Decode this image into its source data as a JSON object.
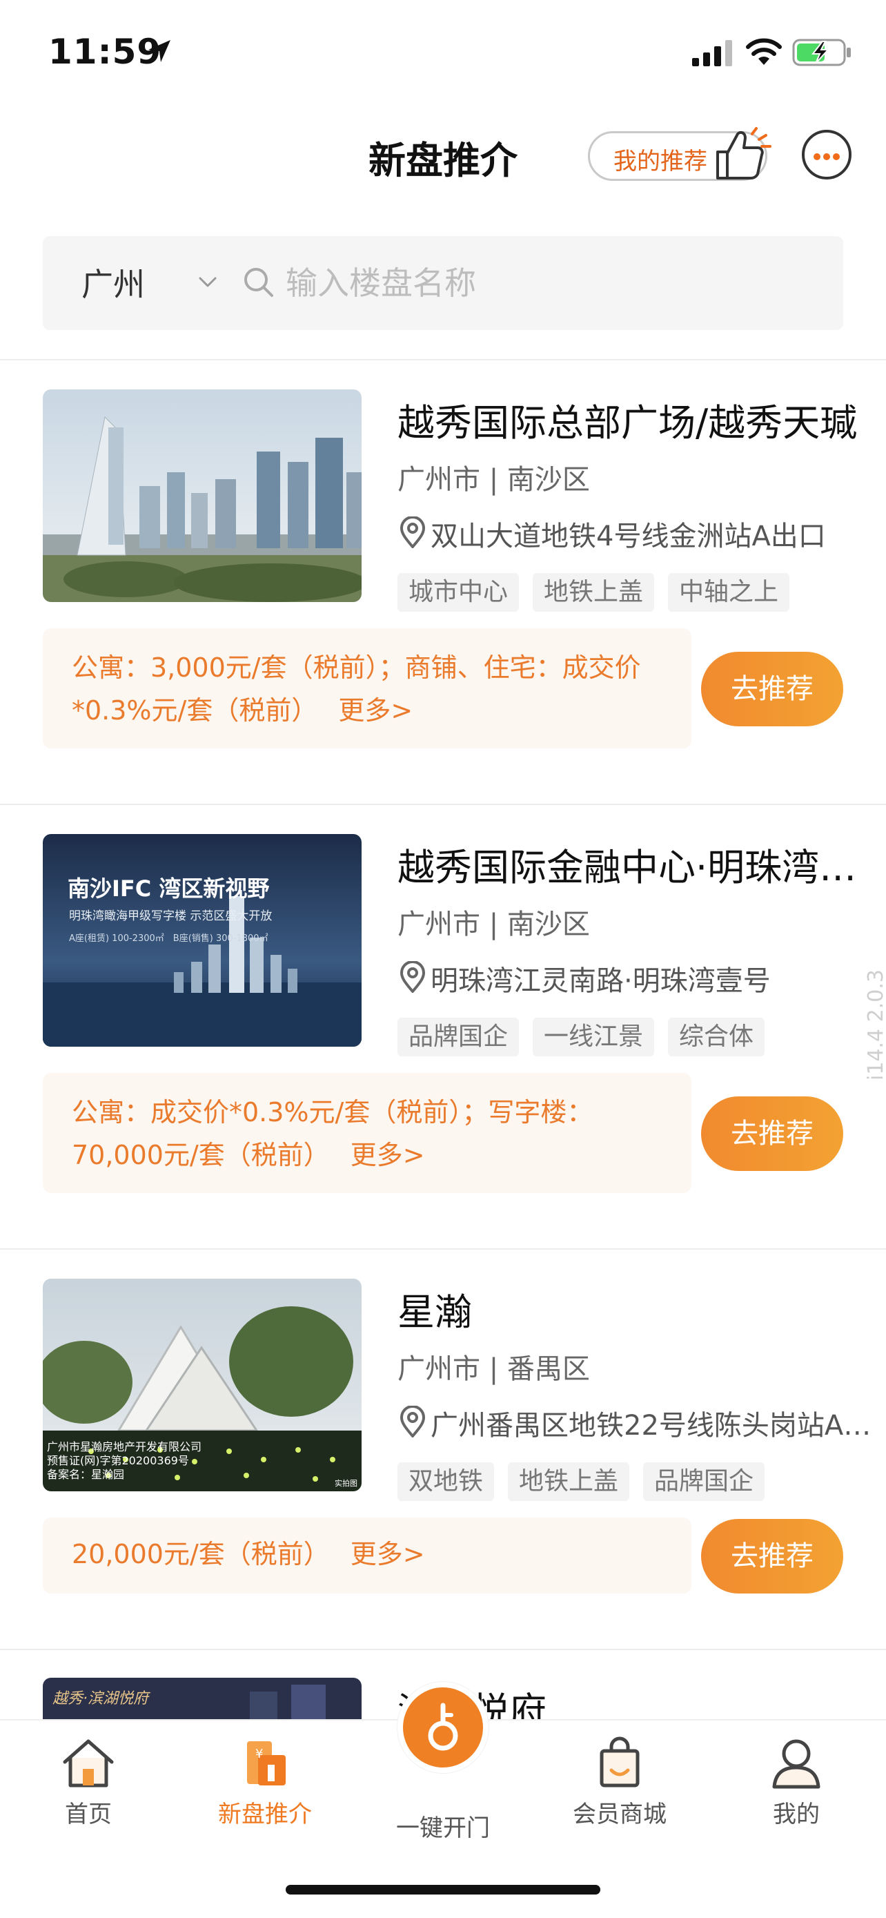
{
  "status_bar": {
    "time": "11:59"
  },
  "header": {
    "title": "新盘推介",
    "my_recommend_label": "我的推荐"
  },
  "search": {
    "city": "广州",
    "placeholder": "输入楼盘名称"
  },
  "listings": [
    {
      "title": "越秀国际总部广场/越秀天瑊",
      "region": "广州市 | 南沙区",
      "address": "双山大道地铁4号线金洲站A出口",
      "tags": [
        "城市中心",
        "地铁上盖",
        "中轴之上"
      ],
      "commission": "公寓：3,000元/套（税前）；商铺、住宅：成交价*0.3%元/套（税前）",
      "more": "更多>",
      "button": "去推荐"
    },
    {
      "title": "越秀国际金融中心·明珠湾…",
      "region": "广州市 | 南沙区",
      "address": "明珠湾江灵南路·明珠湾壹号",
      "tags": [
        "品牌国企",
        "一线江景",
        "综合体"
      ],
      "commission": "公寓：成交价*0.3%元/套（税前）；写字楼：70,000元/套（税前）",
      "more": "更多>",
      "button": "去推荐",
      "image_text": {
        "headline": "南沙IFC 湾区新视野",
        "subline": "明珠湾瞰海甲级写字楼 示范区盛大开放",
        "spec_a": "A座(租赁) 100-2300㎡",
        "spec_b": "B座(销售) 300-1800㎡"
      }
    },
    {
      "title": "星瀚",
      "region": "广州市 | 番禺区",
      "address": "广州番禺区地铁22号线陈头岗站A1…",
      "tags": [
        "双地铁",
        "地铁上盖",
        "品牌国企"
      ],
      "commission": "20,000元/套（税前）",
      "more": "更多>",
      "button": "去推荐",
      "image_text": {
        "line1": "广州市星瀚房地产开发有限公司",
        "line2": "预售证(网)字第20200369号",
        "line3": "备案名：星瀚园",
        "corner": "实拍图"
      }
    },
    {
      "title_partial": "滨湖悦府",
      "image_text": "越秀·滨湖悦府"
    }
  ],
  "version": "i14.4 2.0.3",
  "tab_bar": {
    "home": "首页",
    "new_homes": "新盘推介",
    "one_key_open": "一键开门",
    "member_mall": "会员商城",
    "mine": "我的"
  },
  "colors": {
    "accent": "#ef7a22",
    "commission_bg": "#fdf7f1",
    "button_gradient_start": "#f18a2f",
    "button_gradient_end": "#f3a232"
  }
}
